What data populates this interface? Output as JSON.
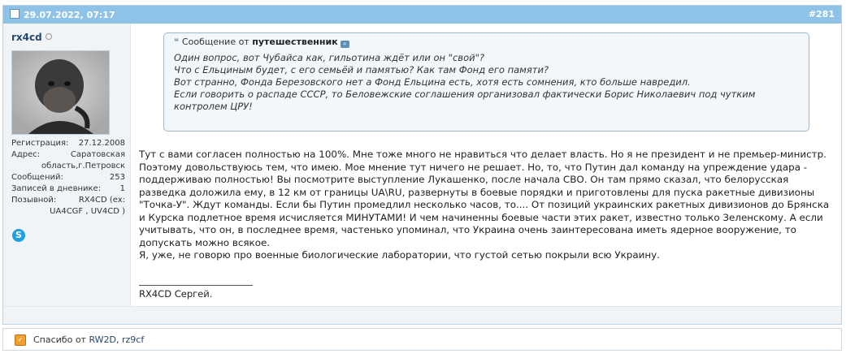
{
  "post": {
    "date": "29.07.2022, 07:17",
    "number": "#281"
  },
  "user": {
    "name": "rx4cd",
    "info": [
      {
        "label": "Регистрация:",
        "value": "27.12.2008"
      },
      {
        "label": "Адрес:",
        "value": "Саратовская"
      },
      {
        "label": "",
        "value": "область,г.Петровск"
      },
      {
        "label": "Сообщений:",
        "value": "253"
      },
      {
        "label": "Записей в дневнике:",
        "value": "1"
      },
      {
        "label": "Позывной:",
        "value": "RX4CD (ex:"
      },
      {
        "label": "",
        "value": "UA4CGF , UV4CD )"
      }
    ]
  },
  "quote": {
    "prefix": "Сообщение от",
    "author": "путешественник",
    "lines": [
      "Один вопрос, вот Чубайса как, гильотина ждёт или он \"свой\"?",
      "Что с Ельциным будет, с его семьёй и памятью? Как там Фонд его памяти?",
      "Вот странно, Фонда Березовского нет а Фонд Ельцина есть, хотя есть сомнения, кто больше навредил.",
      "Если говорить о распаде СССР, то Беловежские соглашения организовал фактически Борис Николаевич под чутким контролем ЦРУ!"
    ]
  },
  "message": {
    "paragraph1": "Тут с вами согласен полностью на 100%. Мне тоже много не нравиться что делает власть. Но я не президент и не премьер-министр. Поэтому довольствуюсь тем, что имею. Мое мнение тут ничего не решает. Но, то, что Путин дал команду на упреждение удара - поддерживаю полностью! Вы посмотрите выступление Лукашенко, после начала СВО. Он там прямо сказал, что белорусская разведка доложила ему, в 12 км от границы UA\\RU, развернуты в боевые порядки и приготовлены для пуска ракетные дивизионы \"Точка-У\". Ждут команды. Если бы Путин промедлил несколько часов, то.... От позиций украинских ракетных дивизионов до Брянска и Курска подлетное время исчисляется МИНУТАМИ! И чем начиненны боевые части этих ракет, известно только Зеленскому. А если учитывать, что он, в последнее время, частенько упоминал, что Украина очень заинтересована иметь ядерное вооружение, то допускать можно всякое.",
    "paragraph2": "Я, уже, не говорю про военные биологические лаборатории, что густой сетью покрыли всю Украину."
  },
  "signature": "RX4CD Сергей.",
  "thanks": {
    "prefix": "Спасибо от",
    "users": [
      "RW2D",
      "rz9cf"
    ],
    "separator": ", "
  },
  "icons": {
    "post": "document-icon",
    "quote": "quote-icon",
    "goto": "view-post-icon",
    "skype": "skype-icon",
    "thanks": "thanks-icon"
  }
}
